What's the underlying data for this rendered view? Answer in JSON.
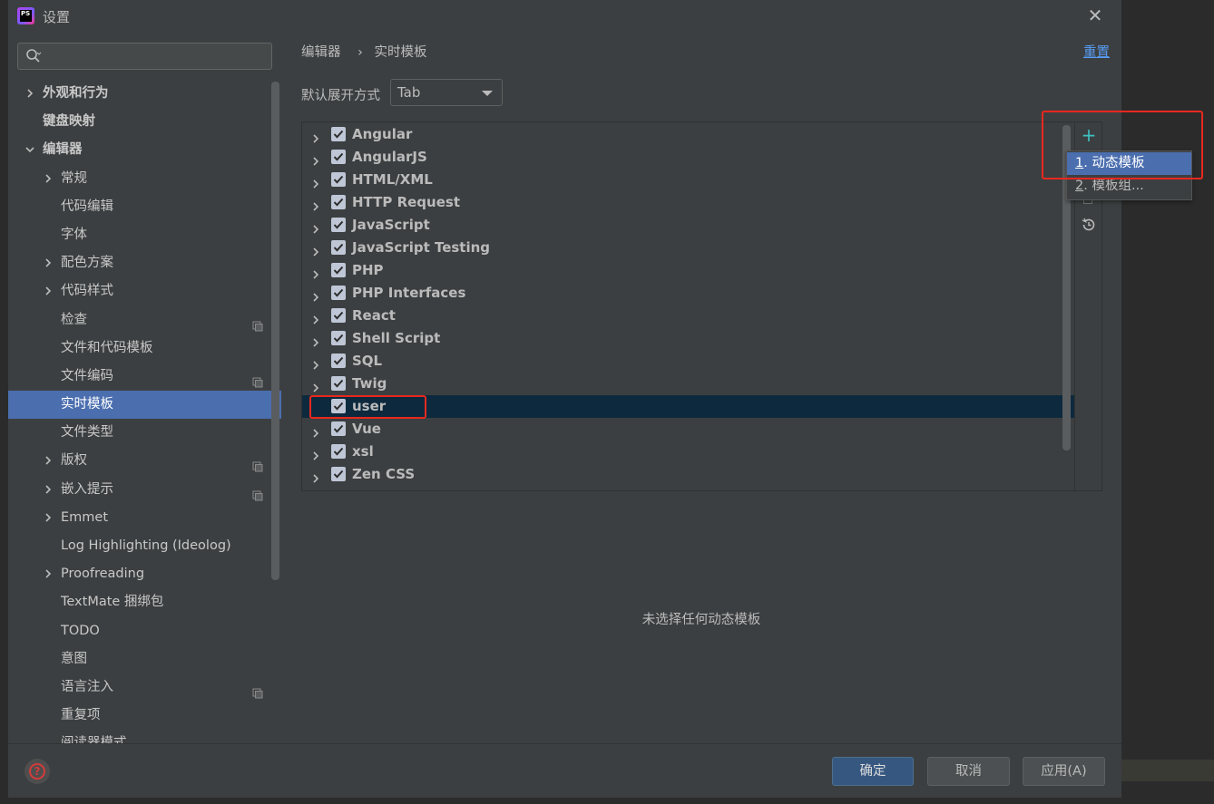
{
  "window": {
    "title": "设置",
    "app_icon_text": "PS"
  },
  "search": {
    "placeholder": ""
  },
  "sidebar": {
    "items": [
      {
        "label": "外观和行为",
        "level": 0,
        "arrow": "right",
        "bold": true
      },
      {
        "label": "键盘映射",
        "level": 0,
        "arrow": "none",
        "bold": true
      },
      {
        "label": "编辑器",
        "level": 0,
        "arrow": "down",
        "bold": true
      },
      {
        "label": "常规",
        "level": 1,
        "arrow": "right"
      },
      {
        "label": "代码编辑",
        "level": 1,
        "arrow": "none"
      },
      {
        "label": "字体",
        "level": 1,
        "arrow": "none"
      },
      {
        "label": "配色方案",
        "level": 1,
        "arrow": "right"
      },
      {
        "label": "代码样式",
        "level": 1,
        "arrow": "right"
      },
      {
        "label": "检查",
        "level": 1,
        "arrow": "none",
        "copy": true
      },
      {
        "label": "文件和代码模板",
        "level": 1,
        "arrow": "none"
      },
      {
        "label": "文件编码",
        "level": 1,
        "arrow": "none",
        "copy": true
      },
      {
        "label": "实时模板",
        "level": 1,
        "arrow": "none",
        "selected": true
      },
      {
        "label": "文件类型",
        "level": 1,
        "arrow": "none"
      },
      {
        "label": "版权",
        "level": 1,
        "arrow": "right",
        "copy": true
      },
      {
        "label": "嵌入提示",
        "level": 1,
        "arrow": "right",
        "copy": true
      },
      {
        "label": "Emmet",
        "level": 1,
        "arrow": "right"
      },
      {
        "label": "Log Highlighting (Ideolog)",
        "level": 1,
        "arrow": "none"
      },
      {
        "label": "Proofreading",
        "level": 1,
        "arrow": "right"
      },
      {
        "label": "TextMate 捆绑包",
        "level": 1,
        "arrow": "none"
      },
      {
        "label": "TODO",
        "level": 1,
        "arrow": "none"
      },
      {
        "label": "意图",
        "level": 1,
        "arrow": "none"
      },
      {
        "label": "语言注入",
        "level": 1,
        "arrow": "none",
        "copy": true
      },
      {
        "label": "重复项",
        "level": 1,
        "arrow": "none"
      },
      {
        "label": "阅读器模式",
        "level": 1,
        "arrow": "none",
        "copy": true
      }
    ]
  },
  "breadcrumb": {
    "parent": "编辑器",
    "separator": "›",
    "current": "实时模板"
  },
  "reset_label": "重置",
  "expand": {
    "label": "默认展开方式",
    "value": "Tab"
  },
  "template_groups": [
    {
      "label": "Angular",
      "checked": true,
      "expandable": true
    },
    {
      "label": "AngularJS",
      "checked": true,
      "expandable": true
    },
    {
      "label": "HTML/XML",
      "checked": true,
      "expandable": true
    },
    {
      "label": "HTTP Request",
      "checked": true,
      "expandable": true
    },
    {
      "label": "JavaScript",
      "checked": true,
      "expandable": true
    },
    {
      "label": "JavaScript Testing",
      "checked": true,
      "expandable": true
    },
    {
      "label": "PHP",
      "checked": true,
      "expandable": true
    },
    {
      "label": "PHP Interfaces",
      "checked": true,
      "expandable": true
    },
    {
      "label": "React",
      "checked": true,
      "expandable": true
    },
    {
      "label": "Shell Script",
      "checked": true,
      "expandable": true
    },
    {
      "label": "SQL",
      "checked": true,
      "expandable": true
    },
    {
      "label": "Twig",
      "checked": true,
      "expandable": true
    },
    {
      "label": "user",
      "checked": true,
      "expandable": false,
      "selected": true
    },
    {
      "label": "Vue",
      "checked": true,
      "expandable": true
    },
    {
      "label": "xsl",
      "checked": true,
      "expandable": true
    },
    {
      "label": "Zen CSS",
      "checked": true,
      "expandable": true
    }
  ],
  "add_menu": {
    "items": [
      {
        "mnemonic": "1",
        "label": ". 动态模板"
      },
      {
        "mnemonic": "2",
        "label": ". 模板组..."
      }
    ]
  },
  "empty_message": "未选择任何动态模板",
  "footer": {
    "ok": "确定",
    "cancel": "取消",
    "apply": "应用(A)"
  },
  "colors": {
    "accent": "#4b6eaf",
    "link": "#589df6",
    "highlight_box": "#e8281e",
    "add_icon": "#3fc0c0"
  }
}
